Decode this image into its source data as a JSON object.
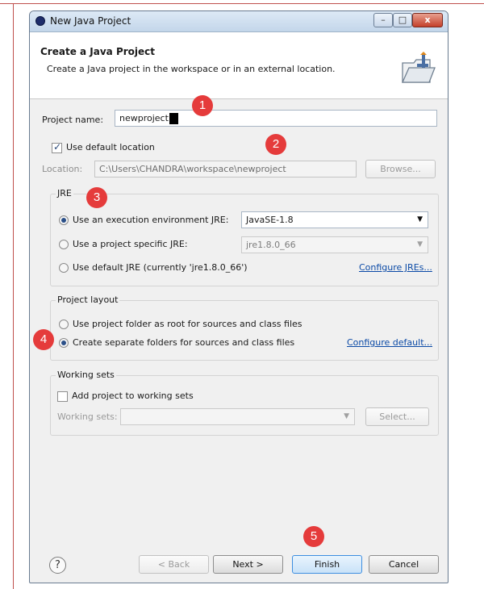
{
  "window": {
    "title": "New Java Project",
    "minimize": "–",
    "maximize": "□",
    "close": "x"
  },
  "header": {
    "title": "Create a Java Project",
    "description": "Create a Java project in the workspace or in an external location."
  },
  "project_name": {
    "label": "Project name:",
    "value": "newproject"
  },
  "default_location": {
    "label": "Use default location",
    "checked": true
  },
  "location": {
    "label": "Location:",
    "value": "C:\\Users\\CHANDRA\\workspace\\newproject",
    "browse_label": "Browse..."
  },
  "jre": {
    "title": "JRE",
    "option_execution_env": "Use an execution environment JRE:",
    "execution_env_value": "JavaSE-1.8",
    "option_project_specific": "Use a project specific JRE:",
    "project_specific_value": "jre1.8.0_66",
    "option_default": "Use default JRE (currently 'jre1.8.0_66')",
    "configure_link": "Configure JREs..."
  },
  "layout": {
    "title": "Project layout",
    "option_root": "Use project folder as root for sources and class files",
    "option_separate": "Create separate folders for sources and class files",
    "configure_link": "Configure default..."
  },
  "working_sets": {
    "title": "Working sets",
    "add_label": "Add project to working sets",
    "sets_label": "Working sets:",
    "select_label": "Select..."
  },
  "footer": {
    "help": "?",
    "back": "< Back",
    "next": "Next >",
    "finish": "Finish",
    "cancel": "Cancel"
  },
  "markers": [
    "1",
    "2",
    "3",
    "4",
    "5"
  ],
  "colors": {
    "marker": "#e53b3b",
    "link": "#0b4aa6",
    "title_bar": "#c3d6ea"
  },
  "icons": [
    "java-app-icon",
    "new-java-project-banner-icon",
    "help-icon",
    "dropdown-arrow-icon"
  ]
}
